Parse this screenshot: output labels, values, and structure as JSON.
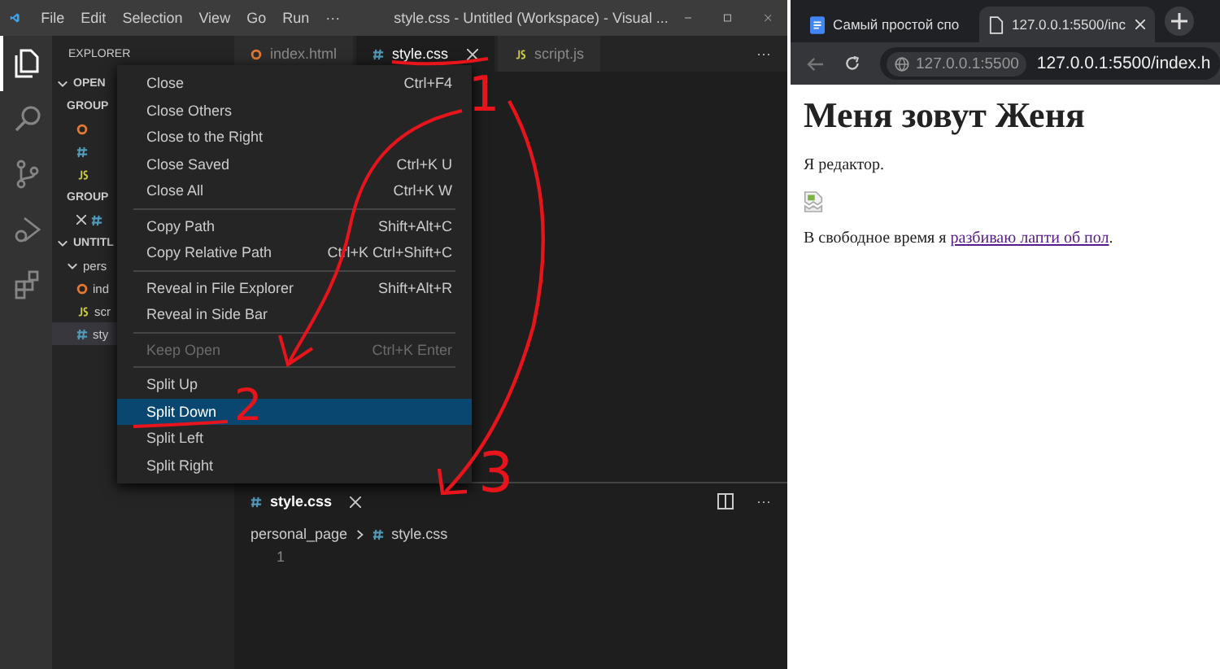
{
  "vscode": {
    "menu": [
      "File",
      "Edit",
      "Selection",
      "View",
      "Go",
      "Run",
      "···"
    ],
    "title": "style.css - Untitled (Workspace) - Visual ...",
    "activity": [
      {
        "selected": true
      },
      {
        "selected": false
      },
      {
        "selected": false
      },
      {
        "selected": false
      },
      {
        "selected": false
      }
    ],
    "explorer": {
      "title": "EXPLORER",
      "tree": [
        {
          "label": "OPEN",
          "expanded": true,
          "children": [
            {
              "label": "GROUP",
              "children": [
                {
                  "kind": "html",
                  "selected": false
                },
                {
                  "kind": "css",
                  "selected": false
                },
                {
                  "kind": "js",
                  "selected": false
                }
              ]
            },
            {
              "label": "GROUP",
              "children": [
                {
                  "kind": "css",
                  "selected": false,
                  "close": true
                }
              ]
            }
          ]
        },
        {
          "label": "UNTITL",
          "expanded": true,
          "children": [
            {
              "label": "pers",
              "expanded": true,
              "children": [
                {
                  "kind": "html",
                  "label": "ind",
                  "selected": false
                },
                {
                  "kind": "js",
                  "label": "scr",
                  "selected": false
                },
                {
                  "kind": "css",
                  "label": "sty",
                  "selected": true
                }
              ]
            }
          ]
        }
      ]
    },
    "tabs": [
      {
        "label": "index.html",
        "kind": "html",
        "selected": false
      },
      {
        "label": "style.css",
        "kind": "css",
        "selected": true
      },
      {
        "label": "script.js",
        "kind": "js",
        "selected": false
      }
    ],
    "context_menu": [
      [
        {
          "label": "Close",
          "shortcut": "Ctrl+F4",
          "disabled": false,
          "selected": false
        },
        {
          "label": "Close Others",
          "disabled": false,
          "selected": false
        },
        {
          "label": "Close to the Right",
          "disabled": false,
          "selected": false
        },
        {
          "label": "Close Saved",
          "shortcut": "Ctrl+K U",
          "disabled": false,
          "selected": false
        },
        {
          "label": "Close All",
          "shortcut": "Ctrl+K W",
          "disabled": false,
          "selected": false
        }
      ],
      [
        {
          "label": "Copy Path",
          "shortcut": "Shift+Alt+C",
          "disabled": false,
          "selected": false
        },
        {
          "label": "Copy Relative Path",
          "shortcut": "Ctrl+K Ctrl+Shift+C",
          "disabled": false,
          "selected": false
        }
      ],
      [
        {
          "label": "Reveal in File Explorer",
          "shortcut": "Shift+Alt+R",
          "disabled": false,
          "selected": false
        },
        {
          "label": "Reveal in Side Bar",
          "disabled": false,
          "selected": false
        }
      ],
      [
        {
          "label": "Keep Open",
          "shortcut": "Ctrl+K Enter",
          "disabled": true,
          "selected": false
        }
      ],
      [
        {
          "label": "Split Up",
          "disabled": false,
          "selected": false
        },
        {
          "label": "Split Down",
          "disabled": false,
          "selected": true
        },
        {
          "label": "Split Left",
          "disabled": false,
          "selected": false
        },
        {
          "label": "Split Right",
          "disabled": false,
          "selected": false
        }
      ]
    ],
    "bottom_group": {
      "tab": {
        "label": "style.css",
        "kind": "css",
        "selected": true
      },
      "more": "···",
      "breadcrumb": [
        {
          "label": "personal_page",
          "kind": "folder"
        },
        {
          "label": "style.css",
          "kind": "css"
        }
      ],
      "line_numbers": [
        "1"
      ]
    },
    "top_more": "···"
  },
  "browser": {
    "tabs": [
      {
        "title": "Самый простой спо",
        "selected": false
      },
      {
        "title": "127.0.0.1:5500/inc",
        "selected": true
      }
    ],
    "address": {
      "site": "127.0.0.1:5500",
      "url": "127.0.0.1:5500/index.h"
    },
    "page": {
      "heading": "Меня зовут Женя",
      "text": "Я редактор.",
      "link_paragraph": {
        "before": "В свободное время я ",
        "link": "разбиваю лапти об пол",
        "after": "."
      }
    }
  },
  "annotations": [
    {
      "label": "1"
    },
    {
      "label": "2"
    },
    {
      "label": "3"
    }
  ]
}
